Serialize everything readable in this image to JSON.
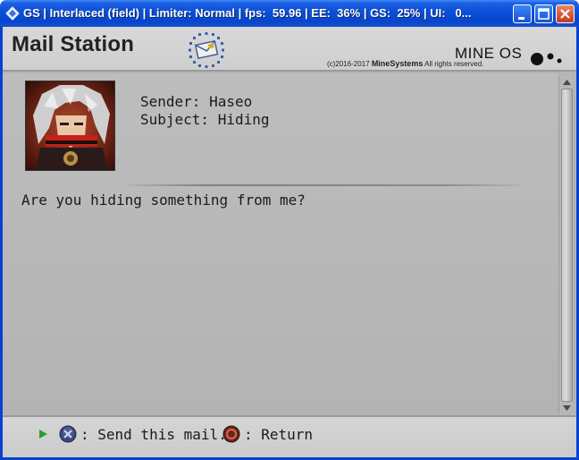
{
  "window": {
    "title": "GS | Interlaced (field) | Limiter: Normal | fps:  59.96 | EE:  36% | GS:  25% | UI:   0...",
    "buttons": [
      "minimize",
      "maximize",
      "close"
    ]
  },
  "header": {
    "app_title": "Mail Station",
    "os_name": "MINE OS",
    "copyright_prefix": "(c)2016-2017 ",
    "copyright_company": "MineSystems",
    "copyright_suffix": " All rights reserved."
  },
  "message": {
    "sender_line": "Sender: Haseo",
    "subject_line": "Subject: Hiding",
    "body": "Are you hiding something from me?"
  },
  "footer": {
    "send_label": ": Send this mail.",
    "return_label": ": Return"
  },
  "icons": {
    "app_icon": "emulator-diamond-icon",
    "mail_logo": "mail-station-logo-icon",
    "avatar": "sender-avatar",
    "play": "play-arrow-icon",
    "cross": "cross-button-icon",
    "circle": "circle-button-icon"
  },
  "colors": {
    "titlebar": "#0a4fd8",
    "client_bg": "#b4b4b4",
    "header_bg": "#d5d5d5",
    "play_arrow": "#2a9d2a",
    "cross_button": "#3a4a7a",
    "circle_button": "#b23a2a"
  }
}
